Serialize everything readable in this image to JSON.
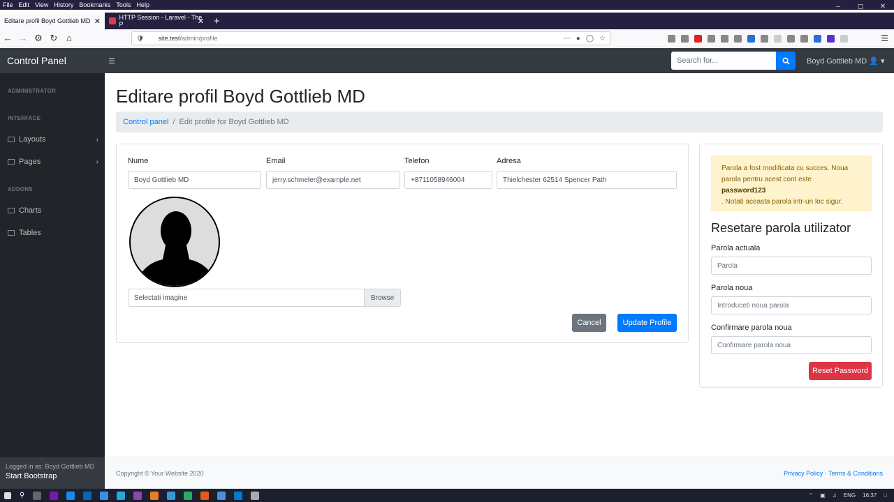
{
  "browser": {
    "menu": [
      "File",
      "Edit",
      "View",
      "History",
      "Bookmarks",
      "Tools",
      "Help"
    ],
    "tabs": [
      {
        "title": "Editare profil Boyd Gottlieb MD",
        "active": true
      },
      {
        "title": "HTTP Session - Laravel - The P",
        "active": false
      }
    ],
    "url_host": "site.test",
    "url_path": "/admin/profile"
  },
  "app": {
    "brand": "Control Panel",
    "search_placeholder": "Search for...",
    "user": "Boyd Gottlieb MD"
  },
  "sidebar": {
    "sections": [
      {
        "heading": "ADMINISTRATOR"
      },
      {
        "heading": "INTERFACE"
      },
      {
        "heading": "ADDONS"
      }
    ],
    "items": [
      {
        "label": "Layouts",
        "icon": "columns-icon"
      },
      {
        "label": "Pages",
        "icon": "book-icon"
      },
      {
        "label": "Charts",
        "icon": "chart-area-icon"
      },
      {
        "label": "Tables",
        "icon": "table-icon"
      }
    ],
    "footer_small": "Logged in as: Boyd Gottlieb MD",
    "footer_big": "Start Bootstrap"
  },
  "page": {
    "title": "Editare profil Boyd Gottlieb MD",
    "breadcrumb_link": "Control panel",
    "breadcrumb_current": "Edit profile for Boyd Gottlieb MD"
  },
  "profile": {
    "fields": [
      {
        "label": "Nume",
        "value": "Boyd Gottlieb MD"
      },
      {
        "label": "Email",
        "value": "jerry.schmeler@example.net"
      },
      {
        "label": "Telefon",
        "value": "+8711058946004"
      },
      {
        "label": "Adresa",
        "value": "Thielchester 62514 Spencer Path"
      }
    ],
    "file_placeholder": "Selectati imagine",
    "browse_label": "Browse",
    "cancel_label": "Cancel",
    "update_label": "Update Profile"
  },
  "password": {
    "alert_line1": "Parola a fost modificata cu succes. Noua parola pentru acest cont este",
    "alert_pw": "password123",
    "alert_line2": ". Notati aceasta parola intr-un loc sigur.",
    "heading": "Resetare parola utilizator",
    "current_label": "Parola actuala",
    "current_placeholder": "Parola",
    "new_label": "Parola noua",
    "new_placeholder": "Introduceti noua parola",
    "confirm_label": "Confirmare parola noua",
    "confirm_placeholder": "Confirmare parola noua",
    "reset_label": "Reset Password"
  },
  "footer": {
    "copyright": "Copyright © Your Website 2020",
    "privacy": "Privacy Policy",
    "dot": "·",
    "terms": "Terms & Conditions"
  },
  "taskbar": {
    "lang": "ENG",
    "time": "16:37"
  },
  "colors": {
    "primary": "#007bff",
    "danger": "#dc3545",
    "secondary": "#6c757d",
    "sidebar": "#212529",
    "topnav": "#343a40"
  }
}
